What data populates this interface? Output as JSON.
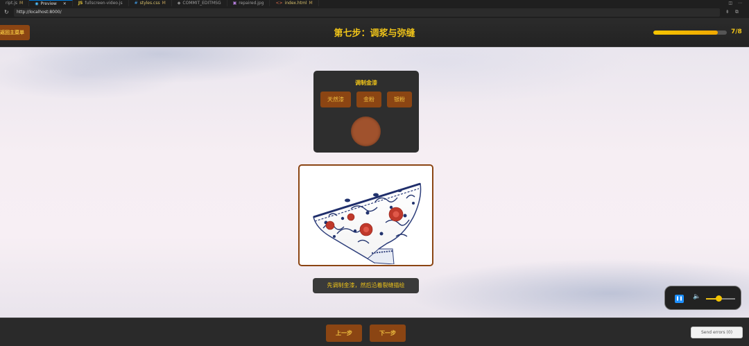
{
  "editor": {
    "tabs": [
      {
        "label": "ript.js",
        "mark": "M",
        "icon": ""
      },
      {
        "label": "Preview",
        "mark": "",
        "icon": "preview-icon",
        "close": "✕"
      },
      {
        "label": "fullscreen-video.js",
        "mark": "",
        "icon": "JS"
      },
      {
        "label": "styles.css",
        "mark": "M",
        "icon": "#"
      },
      {
        "label": "COMMIT_EDITMSG",
        "mark": "",
        "icon": "git-icon"
      },
      {
        "label": "repaired.jpg",
        "mark": "",
        "icon": "image-icon"
      },
      {
        "label": "index.html",
        "mark": "M",
        "icon": "<>"
      }
    ]
  },
  "browser": {
    "url": "http://localhost:8000/"
  },
  "header": {
    "back_label": "返回主菜单",
    "title": "第七步：调浆与弥缝",
    "progress_fraction": 0.875,
    "progress_text": "7/8"
  },
  "mix_panel": {
    "title": "调制金漆",
    "ingredients": [
      "天然漆",
      "金粉",
      "银粉"
    ],
    "bowl_color": "#a0522d"
  },
  "hint": "先调制金漆，然后沿着裂缝描绘",
  "media": {
    "volume_fraction": 0.45
  },
  "footer": {
    "prev_label": "上一步",
    "next_label": "下一步",
    "send_errors_label": "Send errors (0)"
  },
  "colors": {
    "accent": "#f0c419",
    "button": "#8b4513"
  }
}
